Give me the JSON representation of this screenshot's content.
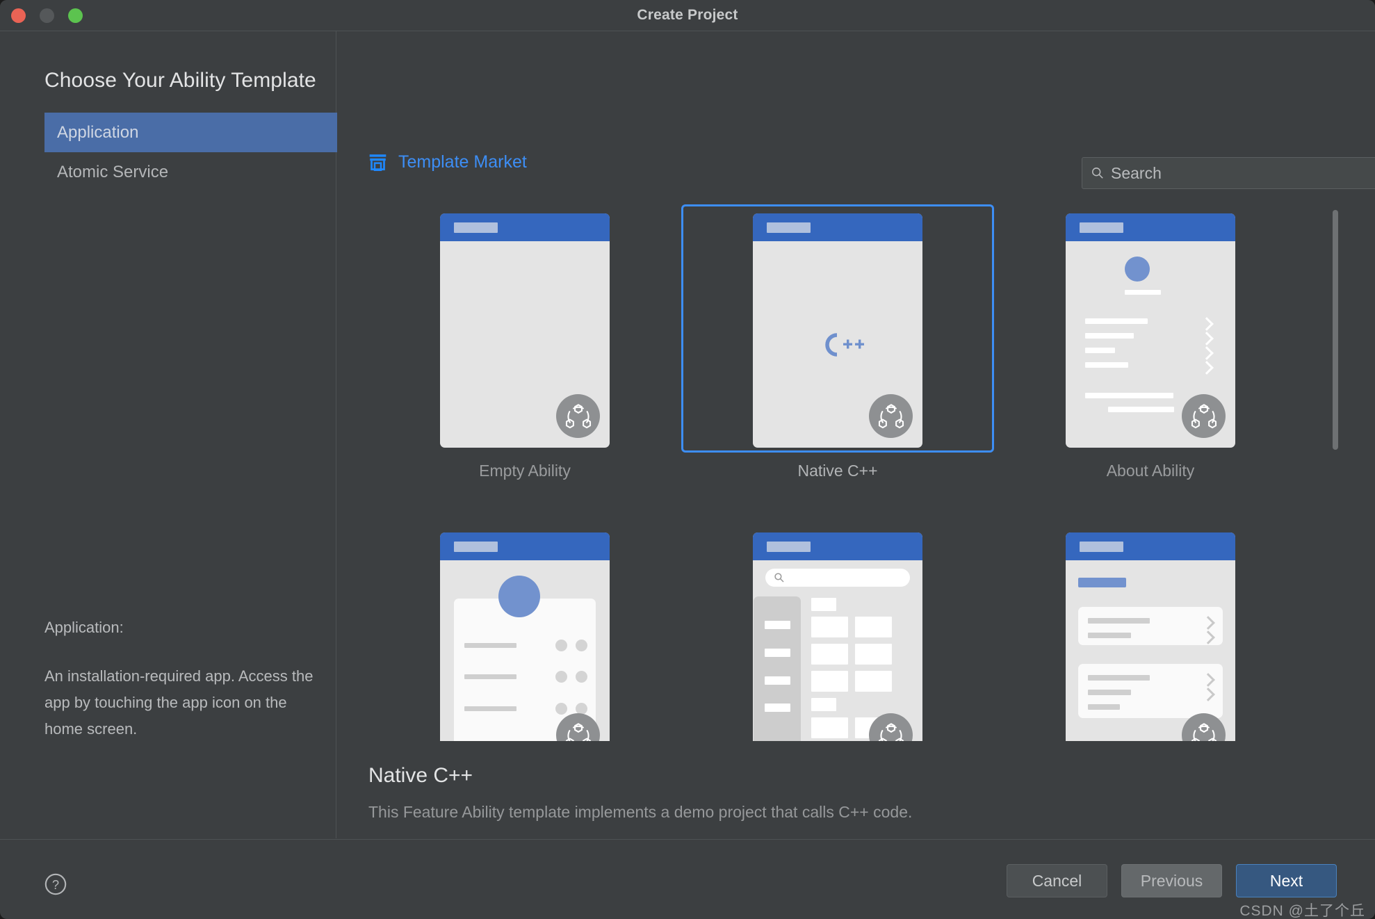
{
  "window": {
    "title": "Create Project",
    "traffic_lights": [
      "close",
      "minimize",
      "zoom"
    ]
  },
  "left": {
    "heading": "Choose Your Ability Template",
    "categories": [
      {
        "label": "Application",
        "selected": true
      },
      {
        "label": "Atomic Service",
        "selected": false
      }
    ],
    "description_title": "Application:",
    "description_body": "An installation-required app. Access the app by touching the app icon on the home screen."
  },
  "right": {
    "market_link": "Template Market",
    "market_icon": "shop-icon",
    "search": {
      "placeholder": "Search",
      "value": "",
      "icon": "search-icon",
      "clear_icon": "close-icon"
    },
    "templates": [
      {
        "label": "Empty Ability",
        "selected": false,
        "kind": "empty"
      },
      {
        "label": "Native C++",
        "selected": true,
        "kind": "cpp"
      },
      {
        "label": "About Ability",
        "selected": false,
        "kind": "about"
      },
      {
        "label": "",
        "selected": false,
        "kind": "profile"
      },
      {
        "label": "",
        "selected": false,
        "kind": "catalog"
      },
      {
        "label": "",
        "selected": false,
        "kind": "settings"
      }
    ],
    "selected_template": {
      "title": "Native C++",
      "description": "This Feature Ability template implements a demo project that calls C++ code."
    }
  },
  "bottom": {
    "help_icon": "question-mark-icon",
    "buttons": [
      {
        "label": "Cancel",
        "style": "plain"
      },
      {
        "label": "Previous",
        "style": "hover"
      },
      {
        "label": "Next",
        "style": "primary"
      }
    ],
    "watermark": "CSDN @土了个丘"
  },
  "colors": {
    "window_bg": "#3c3f41",
    "accent_blue": "#3d8ef5",
    "selection_blue": "#4a6da7",
    "phone_header_blue": "#3567be",
    "primary_button": "#365880"
  }
}
